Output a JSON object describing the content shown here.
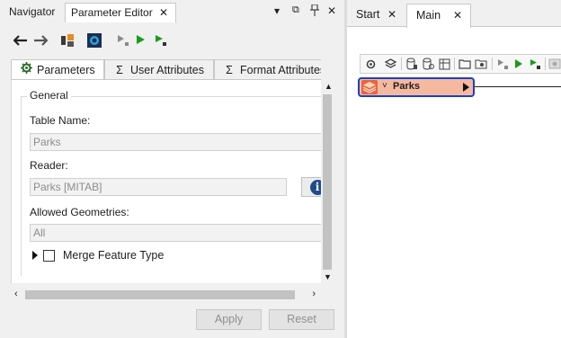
{
  "left_panel": {
    "tabs": [
      {
        "label": "Navigator"
      },
      {
        "label": "Parameter Editor",
        "close": "✕"
      }
    ],
    "window_controls": [
      "▾",
      "⧉",
      "📌",
      "✕"
    ],
    "inner_tabs": [
      {
        "label": "Parameters",
        "icon": "gear-icon"
      },
      {
        "label": "User Attributes",
        "icon": "sigma-icon"
      },
      {
        "label": "Format Attributes",
        "icon": "sigma-icon"
      }
    ],
    "group_title": "General",
    "table_name": {
      "label": "Table Name:",
      "value": "Parks"
    },
    "reader": {
      "label": "Reader:",
      "value": "Parks [MITAB]"
    },
    "allowed_geometries": {
      "label": "Allowed Geometries:",
      "value": "All"
    },
    "merge_feature_type": {
      "label": "Merge Feature Type",
      "checked": false
    },
    "buttons": {
      "apply": "Apply",
      "reset": "Reset"
    }
  },
  "right_panel": {
    "tabs": [
      {
        "label": "Start",
        "close": "✕"
      },
      {
        "label": "Main",
        "close": "✕"
      }
    ],
    "feature_type": {
      "name": "Parks",
      "chevron": "˅"
    }
  },
  "colors": {
    "node_fill": "#f5b9a0",
    "node_border": "#1a3fc7",
    "info_button": "#1f4b87",
    "run_green": "#1a9b1a"
  }
}
